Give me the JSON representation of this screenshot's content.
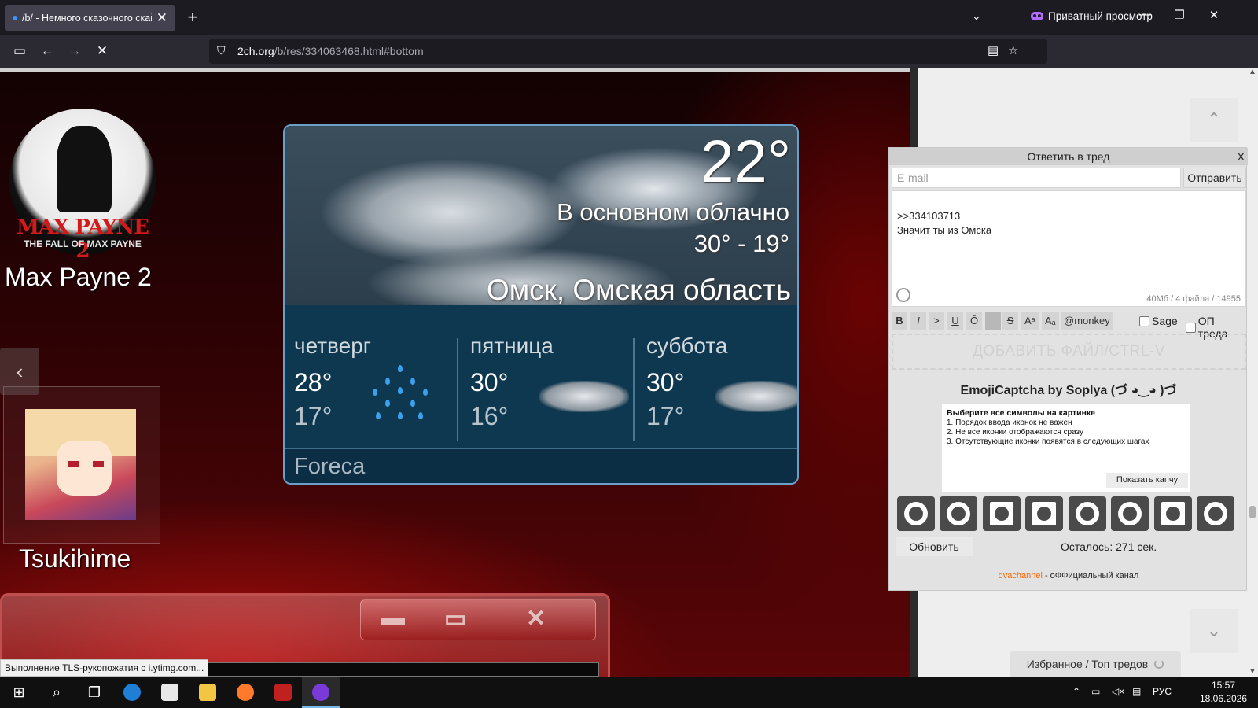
{
  "browser": {
    "tab_title": "/b/ - Немного сказочного скай",
    "tab_close": "✕",
    "new_tab": "+",
    "private_label": "Приватный просмотр",
    "url_host": "2ch.org",
    "url_path": "/b/res/334063468.html#bottom",
    "icons": [
      "sidebar-icon",
      "back-icon",
      "forward-icon",
      "stop-icon",
      "permissions-icon",
      "reader-icon",
      "bookmark-star-icon",
      "account-icon",
      "extensions-icon",
      "fire-icon",
      "menu-icon"
    ]
  },
  "desktop": {
    "maxpayne_logo_title": "MAX PAYNE 2",
    "maxpayne_logo_sub": "THE FALL OF MAX PAYNE",
    "maxpayne_label": "Max Payne 2",
    "tsukihime_label": "Tsukihime"
  },
  "weather": {
    "temp": "22°",
    "condition": "В основном облачно",
    "range": "30°  -  19°",
    "city": "Омск, Омская область",
    "days": [
      {
        "name": "четверг",
        "high": "28°",
        "low": "17°",
        "icon": "rain-icon"
      },
      {
        "name": "пятница",
        "high": "30°",
        "low": "16°",
        "icon": "cloud-icon"
      },
      {
        "name": "суббота",
        "high": "30°",
        "low": "17°",
        "icon": "cloud-icon"
      }
    ],
    "brand": "Foreca"
  },
  "status_tip": "Выполнение TLS-рукопожатия с i.ytimg.com...",
  "reply": {
    "title": "Ответить в тред",
    "close": "X",
    "email_placeholder": "E-mail",
    "send": "Отправить",
    "message": ">>334103713\nЗначит ты из Омска",
    "limits": "40Мб / 4 файла / 14955",
    "format_buttons": [
      "B",
      "I",
      ">",
      "U",
      "Ō",
      "",
      "S",
      "Aᵃ",
      "Aₐ",
      "@monkey"
    ],
    "sage": "Sage",
    "op": "ОП треда",
    "dropzone": "ДОБАВИТЬ ФАЙЛ/CTRL-V",
    "captcha_title": "EmojiCaptcha by Soplya (づ ◕‿◕ )づ",
    "captcha_instr_title": "Выберите все символы на картинке",
    "captcha_lines": [
      "1. Порядок ввода иконок не важен",
      "2. Не все иконки отображаются сразу",
      "3. Отсутствующие иконки появятся в следующих шагах"
    ],
    "show_captcha": "Показать капчу",
    "emoji_icons": [
      "pumpkin-icon",
      "crazy-face-icon",
      "grid-icon",
      "laptop-icon",
      "swimmer-icon",
      "globe-icon",
      "moon-star-icon",
      "bear-icon"
    ],
    "refresh": "Обновить",
    "remaining": "Осталось: 271 сек.",
    "footer_channel": "dvachannel",
    "footer_rest": " - оФФициальный канал"
  },
  "side": {
    "up": "⌃",
    "down": "⌄",
    "favorites": "Избранное / Топ тредов"
  },
  "taskbar": {
    "lang": "РУС",
    "time": "15:57",
    "date": "18.06.2026"
  }
}
